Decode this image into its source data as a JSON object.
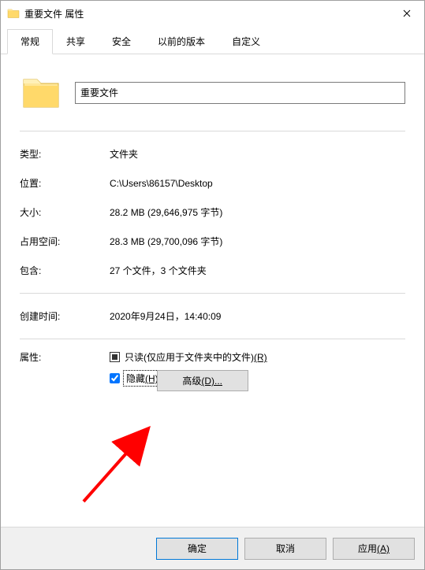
{
  "titlebar": {
    "title": "重要文件 属性"
  },
  "tabs": {
    "items": [
      {
        "label": "常规"
      },
      {
        "label": "共享"
      },
      {
        "label": "安全"
      },
      {
        "label": "以前的版本"
      },
      {
        "label": "自定义"
      }
    ]
  },
  "folder": {
    "name": "重要文件"
  },
  "info": {
    "type_label": "类型:",
    "type_value": "文件夹",
    "location_label": "位置:",
    "location_value": "C:\\Users\\86157\\Desktop",
    "size_label": "大小:",
    "size_value": "28.2 MB (29,646,975 字节)",
    "diskspace_label": "占用空间:",
    "diskspace_value": "28.3 MB (29,700,096 字节)",
    "contains_label": "包含:",
    "contains_value": "27 个文件，3 个文件夹",
    "created_label": "创建时间:",
    "created_value": "2020年9月24日，14:40:09"
  },
  "attributes": {
    "label": "属性:",
    "readonly_label": "只读(仅应用于文件夹中的文件)",
    "readonly_accel": "(R)",
    "hidden_label": "隐藏",
    "hidden_accel": "(H)",
    "advanced_label": "高级",
    "advanced_accel": "(D)..."
  },
  "buttons": {
    "ok": "确定",
    "cancel": "取消",
    "apply_label": "应用",
    "apply_accel": "(A)"
  },
  "colors": {
    "titlebar_bg": "#ffffff",
    "tab_border": "#d9d9d9",
    "button_bg": "#e1e1e1",
    "button_border": "#adadad",
    "default_border": "#0078d7",
    "footer_bg": "#f0f0f0",
    "arrow": "#ff0000"
  }
}
